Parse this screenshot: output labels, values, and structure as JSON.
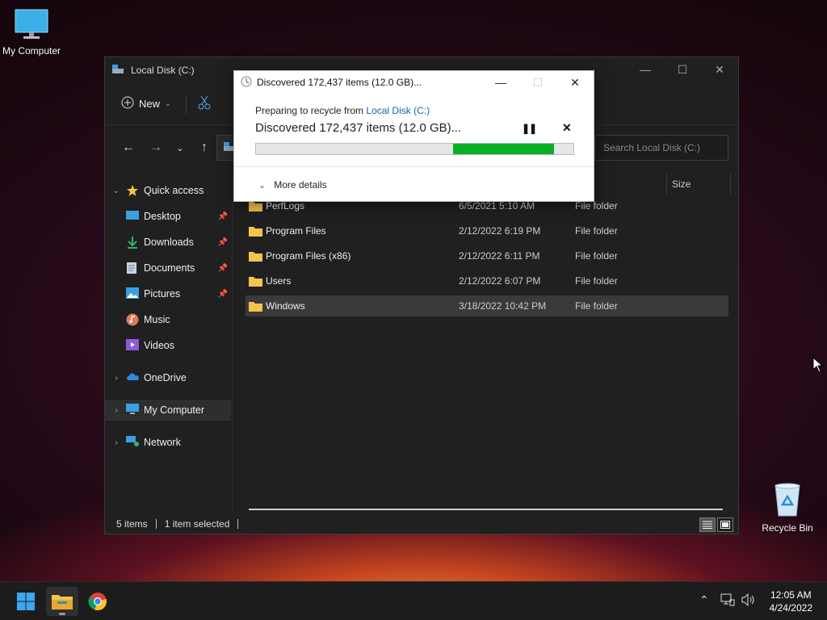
{
  "desktop": {
    "my_computer_label": "My Computer",
    "recycle_bin_label": "Recycle Bin"
  },
  "explorer": {
    "title": "Local Disk (C:)",
    "new_label": "New",
    "search_placeholder": "Search Local Disk (C:)",
    "columns": {
      "size": "Size"
    },
    "sidebar": {
      "quick_access": "Quick access",
      "desktop": "Desktop",
      "downloads": "Downloads",
      "documents": "Documents",
      "pictures": "Pictures",
      "music": "Music",
      "videos": "Videos",
      "onedrive": "OneDrive",
      "my_computer": "My Computer",
      "network": "Network"
    },
    "files": [
      {
        "name": "PerfLogs",
        "date": "6/5/2021 5:10 AM",
        "type": "File folder"
      },
      {
        "name": "Program Files",
        "date": "2/12/2022 6:19 PM",
        "type": "File folder"
      },
      {
        "name": "Program Files (x86)",
        "date": "2/12/2022 6:11 PM",
        "type": "File folder"
      },
      {
        "name": "Users",
        "date": "2/12/2022 6:07 PM",
        "type": "File folder"
      },
      {
        "name": "Windows",
        "date": "3/18/2022 10:42 PM",
        "type": "File folder"
      }
    ],
    "status": {
      "items": "5 items",
      "selected": "1 item selected"
    }
  },
  "dialog": {
    "title": "Discovered 172,437 items (12.0 GB)...",
    "preparing_prefix": "Preparing to recycle from ",
    "preparing_link": "Local Disk (C:)",
    "main_text": "Discovered 172,437 items (12.0 GB)...",
    "more_details": "More details",
    "progress": {
      "start": 0.62,
      "end": 0.94
    }
  },
  "taskbar": {
    "time": "12:05 AM",
    "date": "4/24/2022"
  },
  "colors": {
    "progress_green": "#06b025",
    "link_blue": "#1a5fb4",
    "folder_yellow": "#f3c54a"
  }
}
